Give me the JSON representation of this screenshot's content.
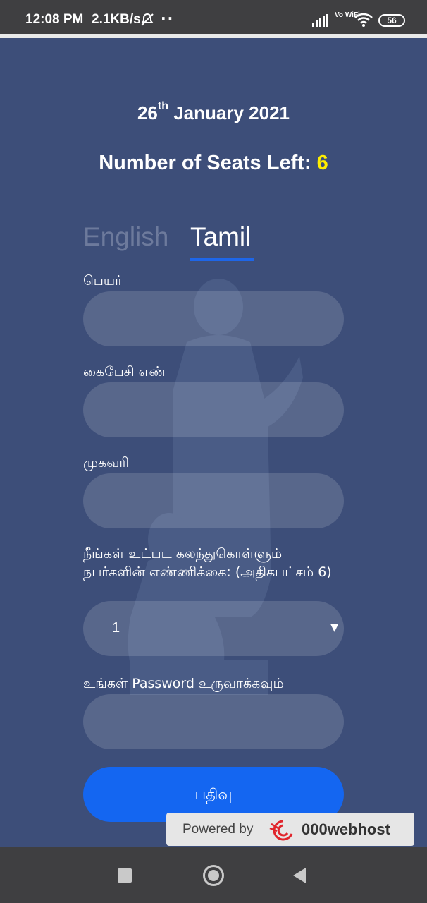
{
  "status_bar": {
    "time": "12:08 PM",
    "speed": "2.1KB/s",
    "dots": "··",
    "vowifi": "Vo WiFi",
    "battery": "56"
  },
  "header": {
    "date_day": "26",
    "date_suffix": "th",
    "date_rest": " January 2021",
    "seats_label": "Number of Seats Left: ",
    "seats_count": "6"
  },
  "tabs": [
    {
      "label": "English",
      "active": false
    },
    {
      "label": "Tamil",
      "active": true
    }
  ],
  "form": {
    "name_label": "பெயர்",
    "name_value": "",
    "phone_label": "கைபேசி எண்",
    "phone_value": "",
    "address_label": "முகவரி",
    "address_value": "",
    "attendees_label": "நீங்கள் உட்பட கலந்துகொள்ளும் நபர்களின் எண்ணிக்கை: (அதிகபட்சம் 6)",
    "attendees_selected": "1",
    "password_label": "உங்கள் Password உருவாக்கவும்",
    "password_value": "",
    "submit_label": "பதிவு"
  },
  "powered": {
    "label": "Powered by",
    "host": "000webhost"
  },
  "colors": {
    "background": "#3d4e79",
    "accent": "#1466f1",
    "seats_highlight": "#ffee00"
  }
}
